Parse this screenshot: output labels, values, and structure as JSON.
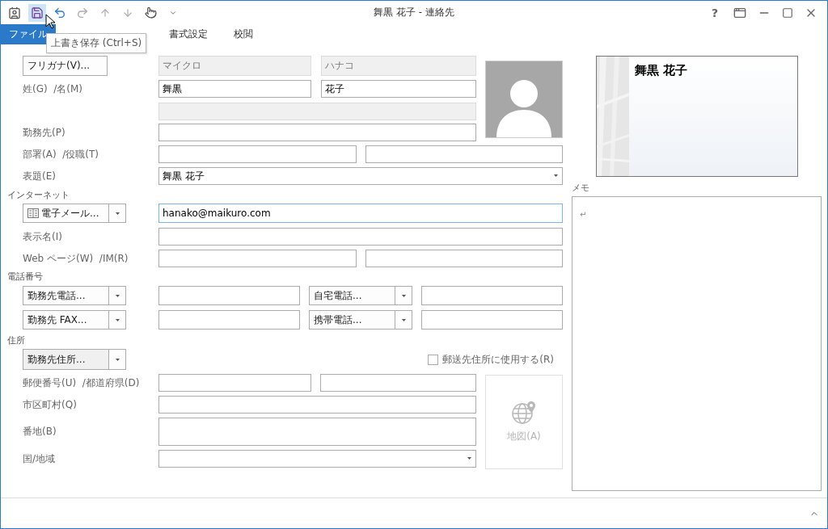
{
  "window": {
    "title": "舞黒 花子 - 連絡先",
    "help_button": "?"
  },
  "tooltip": {
    "text": "上書き保存 (Ctrl+S)"
  },
  "tabs": [
    {
      "label": "ファイル",
      "kind": "file"
    },
    {
      "label": "書式設定",
      "kind": "tab"
    },
    {
      "label": "校閲",
      "kind": "tab"
    }
  ],
  "form": {
    "furigana_button": "フリガナ(V)...",
    "furigana": [
      "マイクロ",
      "ハナコ"
    ],
    "name_label": "姓(G)  /名(M)",
    "last_name": "舞黒",
    "first_name": "花子",
    "company_label": "勤務先(P)",
    "dept_label": "部署(A)  /役職(T)",
    "file_as_label": "表題(E)",
    "file_as": "舞黒 花子",
    "internet_heading": "インターネット",
    "email_button": "電子メール...",
    "email": "hanako@maikuro.com",
    "display_name_label": "表示名(I)",
    "web_label": "Web ページ(W)  /IM(R)",
    "phone_heading": "電話番号",
    "phones": [
      {
        "button": "勤務先電話..."
      },
      {
        "button": "自宅電話..."
      },
      {
        "button": "勤務先 FAX..."
      },
      {
        "button": "携帯電話..."
      }
    ],
    "address_heading": "住所",
    "address_button": "勤務先住所...",
    "mailing_checkbox": {
      "label": "郵送先住所に使用する(R)",
      "checked": false
    },
    "zip_label": "郵便番号(U)  /都道府県(D)",
    "city_label": "市区町村(Q)",
    "street_label": "番地(B)",
    "country_label": "国/地域",
    "map_button": {
      "label": "地図(A)",
      "disabled": true
    }
  },
  "card": {
    "name": "舞黒 花子"
  },
  "memo": {
    "label": "メモ",
    "text": "↵"
  }
}
